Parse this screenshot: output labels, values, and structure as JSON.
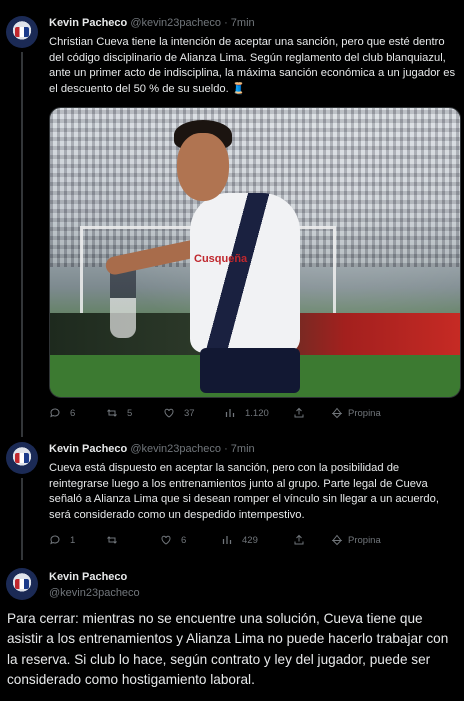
{
  "tweets": [
    {
      "name": "Kevin Pacheco",
      "handle": "@kevin23pacheco",
      "separator": "·",
      "time": "7min",
      "text": "Christian Cueva tiene la intención de aceptar una sanción, pero que esté dentro del código disciplinario de Alianza Lima. Según reglamento del club blanquiazul, ante un primer acto de indisciplina, la máxima sanción económica a un jugador es el descuento del 50 % de su sueldo. 🧵",
      "replies": "6",
      "retweets": "5",
      "likes": "37",
      "views": "1.120",
      "promo": "Propina"
    },
    {
      "name": "Kevin Pacheco",
      "handle": "@kevin23pacheco",
      "separator": "·",
      "time": "7min",
      "text": "Cueva está dispuesto en aceptar la sanción, pero con la posibilidad de reintegrarse luego a los entrenamientos junto al grupo. Parte legal de Cueva señaló a Alianza Lima que si desean romper el vínculo sin llegar a un acuerdo, será considerado como un despedido intempestivo.",
      "replies": "1",
      "retweets": "",
      "likes": "6",
      "views": "429",
      "promo": "Propina"
    }
  ],
  "final": {
    "name": "Kevin Pacheco",
    "handle": "@kevin23pacheco",
    "text": "Para cerrar: mientras no se encuentre una solución, Cueva tiene que asistir a los entrenamientos y Alianza Lima no puede hacerlo trabajar con la reserva. Si club lo hace, según contrato y ley del jugador, puede ser considerado como hostigamiento laboral."
  },
  "media": {
    "jersey_sponsor": "Cusqueña"
  },
  "colors": {
    "background": "#000000",
    "text": "#e7e9ea",
    "muted": "#71767b",
    "divider": "#2f3336"
  }
}
